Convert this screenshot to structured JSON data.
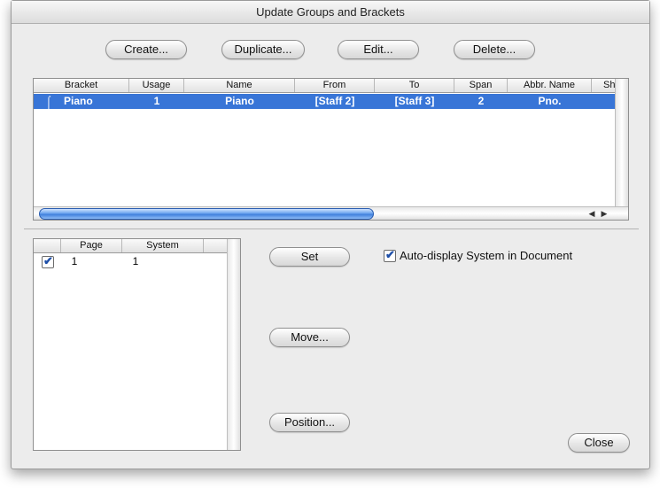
{
  "window": {
    "title": "Update Groups and Brackets"
  },
  "top_buttons": {
    "create": "Create...",
    "duplicate": "Duplicate...",
    "edit": "Edit...",
    "delete": "Delete..."
  },
  "groups_table": {
    "columns": [
      "Bracket",
      "Usage",
      "Name",
      "From",
      "To",
      "Span",
      "Abbr. Name",
      "Show"
    ],
    "rows": [
      {
        "bracket": "Piano",
        "usage": "1",
        "name": "Piano",
        "from": "[Staff 2]",
        "to": "[Staff 3]",
        "span": "2",
        "abbr": "Pno.",
        "selected": true
      }
    ]
  },
  "systems_table": {
    "columns": [
      "",
      "Page",
      "System"
    ],
    "rows": [
      {
        "checked": true,
        "page": "1",
        "system": "1"
      }
    ]
  },
  "side_buttons": {
    "set": "Set",
    "move": "Move...",
    "position": "Position..."
  },
  "auto_display": {
    "label": "Auto-display System in Document",
    "checked": true
  },
  "close_button": "Close",
  "colors": {
    "selection": "#3875d7",
    "scroll_thumb": "#4a86e0"
  }
}
